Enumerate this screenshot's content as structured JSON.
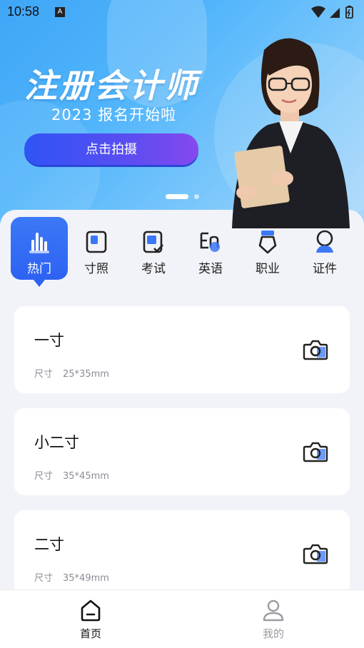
{
  "status_bar": {
    "time": "10:58",
    "notification_badge": "A"
  },
  "banner": {
    "title": "注册会计师",
    "subtitle": "2023 报名开始啦",
    "button_label": "点击拍摄"
  },
  "categories": [
    {
      "label": "热门",
      "icon": "chart-bars-icon",
      "active": true
    },
    {
      "label": "寸照",
      "icon": "photo-frame-icon",
      "active": false
    },
    {
      "label": "考试",
      "icon": "exam-check-icon",
      "active": false
    },
    {
      "label": "英语",
      "icon": "english-en-icon",
      "active": false
    },
    {
      "label": "职业",
      "icon": "badge-icon",
      "active": false
    },
    {
      "label": "证件",
      "icon": "id-person-icon",
      "active": false
    }
  ],
  "items": [
    {
      "name": "一寸",
      "size_label": "尺寸",
      "size": "25*35mm"
    },
    {
      "name": "小二寸",
      "size_label": "尺寸",
      "size": "35*45mm"
    },
    {
      "name": "二寸",
      "size_label": "尺寸",
      "size": "35*49mm"
    }
  ],
  "bottom_nav": [
    {
      "label": "首页",
      "icon": "home-icon",
      "active": true
    },
    {
      "label": "我的",
      "icon": "profile-icon",
      "active": false
    }
  ],
  "colors": {
    "accent": "#2e62f2",
    "active_text": "#111111",
    "inactive_text": "#9a9ca3"
  }
}
